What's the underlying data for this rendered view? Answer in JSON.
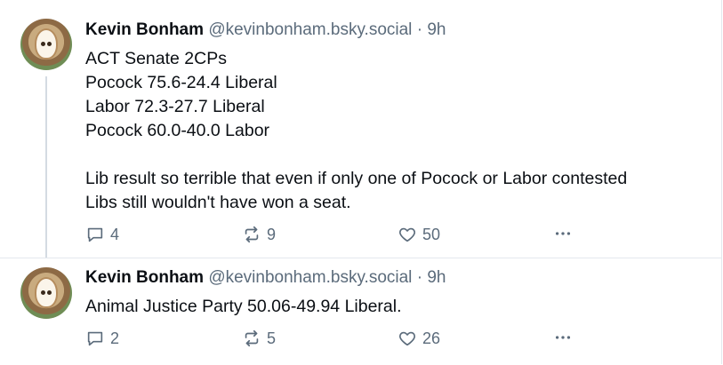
{
  "posts": [
    {
      "author_name": "Kevin Bonham",
      "handle": "@kevinbonham.bsky.social",
      "separator": "·",
      "time": "9h",
      "body_lines": [
        "ACT Senate 2CPs",
        "Pocock 75.6-24.4 Liberal",
        "Labor 72.3-27.7 Liberal",
        "Pocock 60.0-40.0 Labor",
        "",
        "Lib result so terrible that even if only one of Pocock or Labor contested",
        "Libs still wouldn't have won a seat."
      ],
      "reply_count": "4",
      "repost_count": "9",
      "like_count": "50"
    },
    {
      "author_name": "Kevin Bonham",
      "handle": "@kevinbonham.bsky.social",
      "separator": "·",
      "time": "9h",
      "body_lines": [
        "Animal Justice Party 50.06-49.94 Liberal."
      ],
      "reply_count": "2",
      "repost_count": "5",
      "like_count": "26"
    }
  ],
  "icons": {
    "reply": "speech-bubble-icon",
    "repost": "repost-arrows-icon",
    "like": "heart-icon",
    "more": "ellipsis-icon"
  },
  "colors": {
    "text": "#0b0f14",
    "muted": "#5b6b7b",
    "divider": "#e3e8ee",
    "thread_line": "#d4dbe2"
  }
}
